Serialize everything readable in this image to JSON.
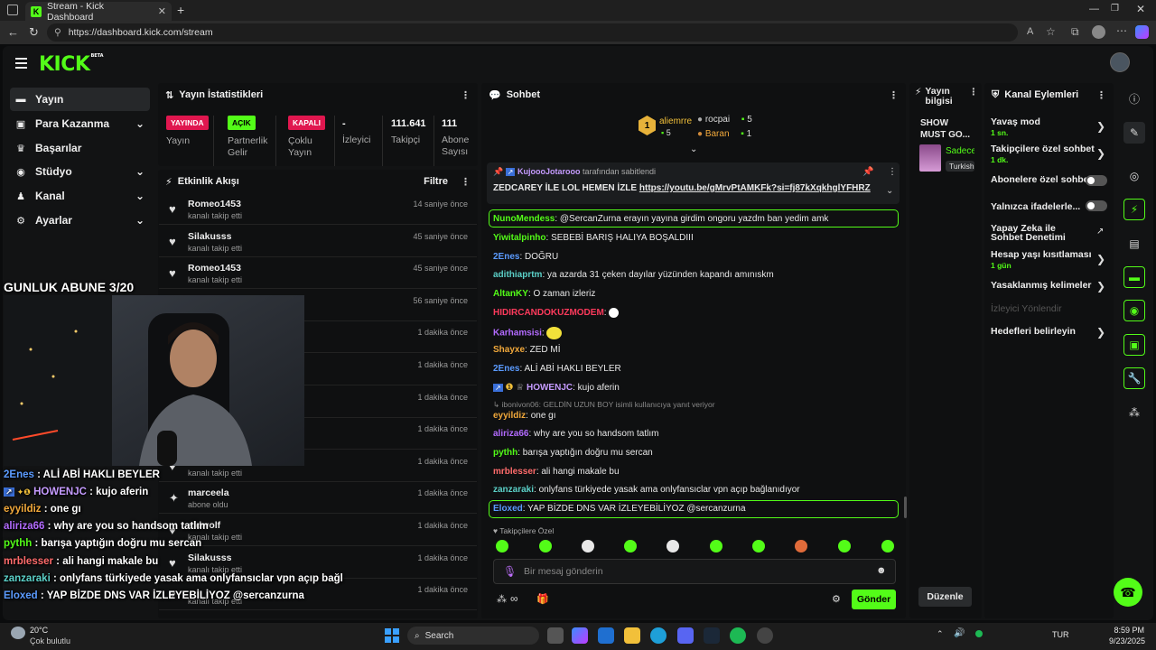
{
  "browser": {
    "tab_title": "Stream - Kick Dashboard",
    "url": "https://dashboard.kick.com/stream"
  },
  "app": {
    "logo": "KICK",
    "logo_tag": "BETA"
  },
  "sidebar": {
    "items": [
      {
        "label": "Yayın",
        "icon": "video-icon"
      },
      {
        "label": "Para Kazanma",
        "icon": "money-icon"
      },
      {
        "label": "Başarılar",
        "icon": "trophy-icon"
      },
      {
        "label": "Stüdyo",
        "icon": "studio-icon"
      },
      {
        "label": "Kanal",
        "icon": "users-icon"
      },
      {
        "label": "Ayarlar",
        "icon": "gear-icon"
      }
    ]
  },
  "stats": {
    "title": "Yayın İstatistikleri",
    "cols": [
      {
        "badge": "YAYINDA",
        "label": "Yayın"
      },
      {
        "badge": "AÇIK",
        "label": "Partnerlik Gelir"
      },
      {
        "badge": "KAPALI",
        "label": "Çoklu Yayın"
      },
      {
        "value": "-",
        "label": "İzleyici"
      },
      {
        "value": "111.641",
        "label": "Takipçi"
      },
      {
        "value": "111",
        "label": "Abone Sayısı"
      }
    ]
  },
  "activity": {
    "title": "Etkinlik Akışı",
    "filter": "Filtre",
    "rows": [
      {
        "name": "Romeo1453",
        "sub": "kanalı takip etti",
        "time": "14 saniye önce"
      },
      {
        "name": "Silakusss",
        "sub": "kanalı takip etti",
        "time": "45 saniye önce"
      },
      {
        "name": "Romeo1453",
        "sub": "kanalı takip etti",
        "time": "45 saniye önce"
      },
      {
        "name": "",
        "sub": "",
        "time": "56 saniye önce"
      },
      {
        "name": "",
        "sub": "",
        "time": "1 dakika önce"
      },
      {
        "name": "",
        "sub": "",
        "time": "1 dakika önce"
      },
      {
        "name": "",
        "sub": "",
        "time": "1 dakika önce"
      },
      {
        "name": "",
        "sub": "",
        "time": "1 dakika önce"
      },
      {
        "name": "Silakusss",
        "sub": "kanalı takip etti",
        "time": "1 dakika önce"
      },
      {
        "name": "marceela",
        "sub": "abone oldu",
        "time": "1 dakika önce"
      },
      {
        "name": "sidwolf",
        "sub": "kanalı takip etti",
        "time": "1 dakika önce"
      },
      {
        "name": "Silakusss",
        "sub": "kanalı takip etti",
        "time": "1 dakika önce"
      },
      {
        "name": "",
        "sub": "kanalı takip etti",
        "time": "1 dakika önce"
      }
    ]
  },
  "overlay": {
    "banner": "GUNLUK ABUNE 3/20",
    "lines": [
      {
        "user": "2Enes",
        "text": " : ALİ ABİ HAKLI BEYLER",
        "color": "#5b9bff"
      },
      {
        "user": "HOWENJC",
        "text": " : kujo aferin",
        "color": "#c59bff"
      },
      {
        "user": "eyyildiz",
        "text": " : one gı",
        "color": "#f2a93b"
      },
      {
        "user": "aliriza66",
        "text": " : why are you so handsom tatlım",
        "color": "#b36bff"
      },
      {
        "user": "pythh",
        "text": " : barışa yaptığın doğru mu sercan",
        "color": "#53fc18"
      },
      {
        "user": "mrblesser",
        "text": " : ali hangi makale bu",
        "color": "#ff6b6b"
      },
      {
        "user": "zanzaraki",
        "text": " : onlyfans türkiyede yasak ama onlyfansıclar vpn açıp bağl",
        "color": "#5bd0c8"
      },
      {
        "user": "Eloxed",
        "text": " : YAP BİZDE DNS VAR İZLEYEBİLİYOZ @sercanzurna",
        "color": "#5b9bff"
      }
    ]
  },
  "chat": {
    "title": "Sohbet",
    "top": [
      {
        "name": "aliemrre",
        "count": "5"
      },
      {
        "name": "rocpai",
        "count": "5"
      },
      {
        "name": "Baran",
        "count": "1"
      }
    ],
    "pinned": {
      "by": "KujoooJotarooo",
      "by_suffix": "tarafından sabitlendi",
      "text": "ZEDCAREY İLE LOL HEMEN İZLE ",
      "link": "https://youtu.be/gMrvPtAMKFk?si=fj87kXqkhglYFHRZ"
    },
    "messages": [
      {
        "user": "NunoMendess",
        "text": ": @SercanZurna erayın yayına girdim ongoru yazdm ban yedim amk",
        "color": "#53fc18"
      },
      {
        "user": "Yiwitalpinho",
        "text": ": SEBEBİ BARIŞ HALIYA BOŞALDIII",
        "color": "#53fc18"
      },
      {
        "user": "2Enes",
        "text": ": DOĞRU",
        "color": "#5b9bff"
      },
      {
        "user": "adithiaprtm",
        "text": ": ya azarda 31 çeken dayılar yüzünden kapandı amınıskm",
        "color": "#5bd0c8"
      },
      {
        "user": "AltanKY",
        "text": ": O zaman izleriz",
        "color": "#53fc18"
      },
      {
        "user": "HIDIRCANDOKUZMODEM",
        "text": ": ",
        "color": "#ff3a5c"
      },
      {
        "user": "Karhamsisi",
        "text": ": ",
        "color": "#b36bff"
      },
      {
        "user": "Shayxe",
        "text": ": ZED Mİ",
        "color": "#f2a93b"
      },
      {
        "user": "2Enes",
        "text": ": ALİ ABİ HAKLI BEYLER",
        "color": "#5b9bff"
      },
      {
        "user": "HOWENJC",
        "text": ": kujo aferin",
        "color": "#c59bff"
      },
      {
        "user": "eyyildiz",
        "text": ": one gı",
        "color": "#f2a93b"
      },
      {
        "user": "aliriza66",
        "text": ": why are you so handsom tatlım",
        "color": "#b36bff"
      },
      {
        "user": "pythh",
        "text": ": barışa yaptığın doğru mu sercan",
        "color": "#53fc18"
      },
      {
        "user": "mrblesser",
        "text": ": ali hangi makale bu",
        "color": "#ff6b6b"
      },
      {
        "user": "zanzaraki",
        "text": ": onlyfans türkiyede yasak ama onlyfansıclar vpn açıp bağlanıdıyor",
        "color": "#5bd0c8"
      },
      {
        "user": "Eloxed",
        "text": ": YAP BİZDE DNS VAR İZLEYEBİLİYOZ @sercanzurna",
        "color": "#5b9bff"
      }
    ],
    "reply_ref": "ibonivon06: GELDİN UZUN BOY  isimli kullanıcıya yanıt veriyor",
    "emote_label": "Takipçilere Özel",
    "input_placeholder": "Bir mesaj gönderin",
    "send": "Gönder"
  },
  "info": {
    "title": "Yayın bilgisi",
    "stream_title": "SHOW MUST GO...",
    "category": "Sadece",
    "tag": "Turkish",
    "edit": "Düzenle"
  },
  "actions": {
    "title": "Kanal Eylemleri",
    "items": [
      {
        "label": "Yavaş mod",
        "sub": "1 sn."
      },
      {
        "label": "Takipçilere özel sohbet",
        "sub": "1 dk."
      },
      {
        "label": "Abonelere özel sohbet"
      },
      {
        "label": "Yalnızca ifadelerle..."
      },
      {
        "label": "Yapay Zeka ile Sohbet Denetimi"
      },
      {
        "label": "Hesap yaşı kısıtlaması",
        "sub": "1 gün"
      },
      {
        "label": "Yasaklanmış kelimeler"
      },
      {
        "label": "İzleyici Yönlendir"
      },
      {
        "label": "Hedefleri belirleyin"
      }
    ]
  },
  "taskbar": {
    "weather_temp": "20°C",
    "weather_text": "Çok bulutlu",
    "search": "Search",
    "lang": "TUR",
    "time": "8:59 PM",
    "date": "9/23/2025"
  },
  "colors": {
    "accent": "#53fc18",
    "live": "#e91e63"
  }
}
